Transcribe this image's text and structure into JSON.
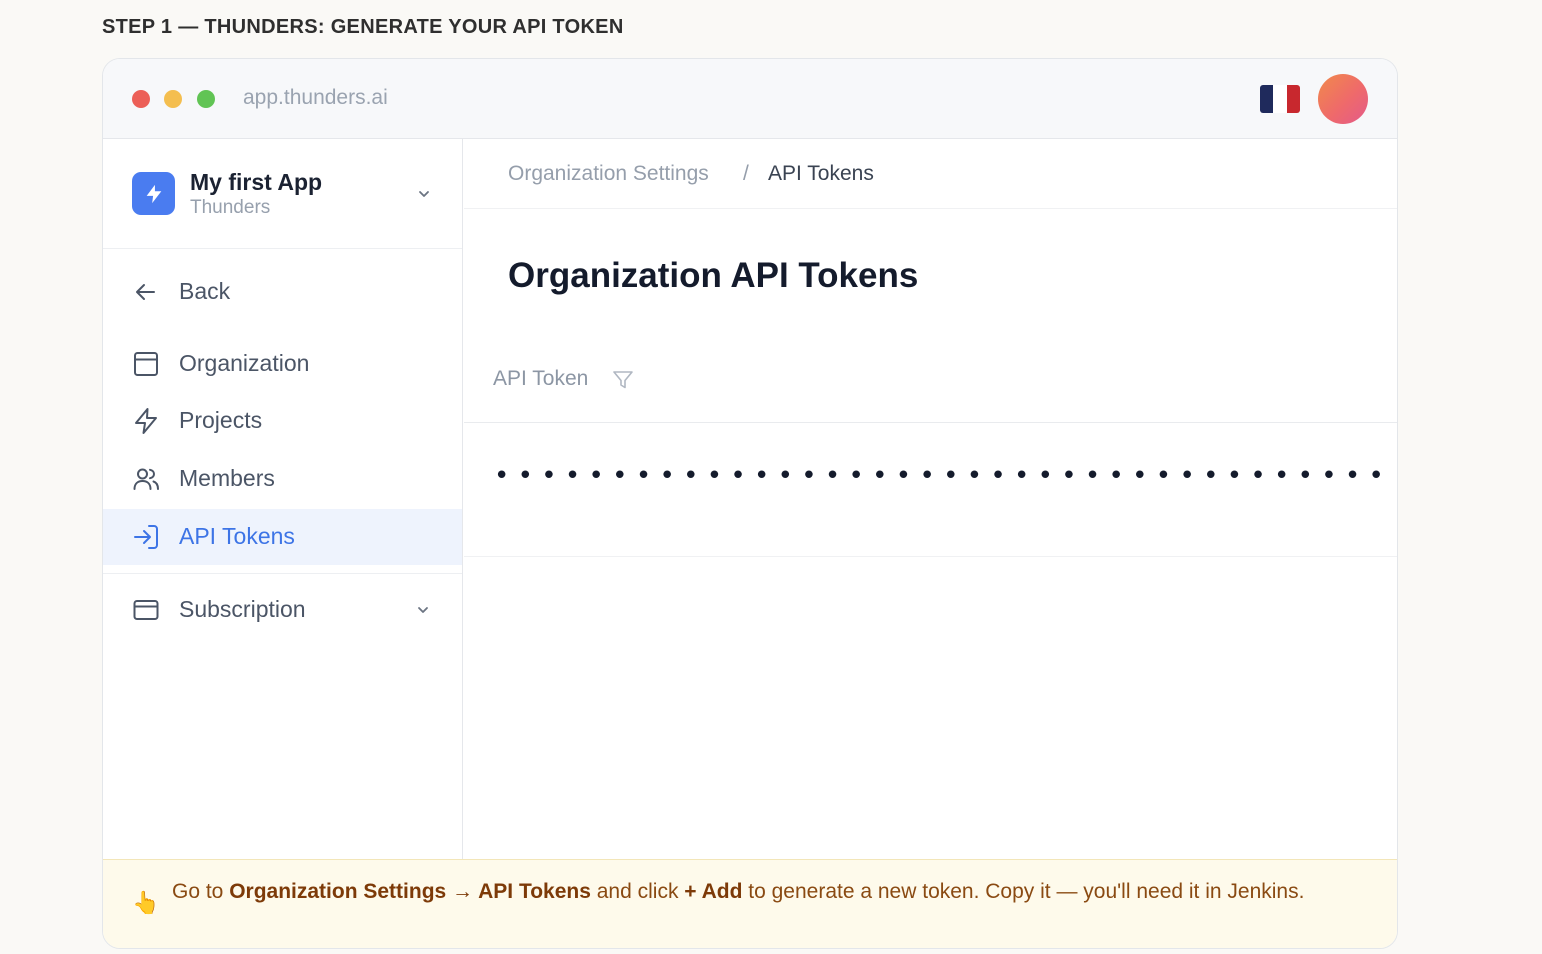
{
  "step": {
    "title": "STEP 1 — THUNDERS: GENERATE YOUR API TOKEN"
  },
  "browser": {
    "url": "app.thunders.ai",
    "flag": {
      "name": "france-flag",
      "colors": [
        "#1f2a5c",
        "#ffffff",
        "#c8282e"
      ]
    },
    "avatar": {
      "name": "user-avatar"
    }
  },
  "sidebar": {
    "app": {
      "name": "My first App",
      "org": "Thunders",
      "icon": "lightning-icon"
    },
    "back": {
      "label": "Back",
      "icon": "arrow-left-icon"
    },
    "items": [
      {
        "label": "Organization",
        "icon": "window-icon",
        "active": false
      },
      {
        "label": "Projects",
        "icon": "lightning-outline-icon",
        "active": false
      },
      {
        "label": "Members",
        "icon": "users-icon",
        "active": false
      },
      {
        "label": "API Tokens",
        "icon": "sign-in-icon",
        "active": true
      }
    ],
    "subscription": {
      "label": "Subscription",
      "icon": "card-icon"
    }
  },
  "main": {
    "breadcrumb": {
      "parent": "Organization Settings",
      "separator": "/",
      "current": "API Tokens"
    },
    "title": "Organization API Tokens",
    "table": {
      "column": "API Token",
      "rows": [
        {
          "token": "••••••••••••••••••••••••••••••••••••••••••••••"
        }
      ]
    }
  },
  "tip": {
    "emoji": "👆",
    "prefix": "Go to ",
    "path": "Organization Settings → API Tokens",
    "mid": " and click ",
    "action": "+ Add",
    "suffix": " to generate a new token. Copy it — you'll need it in Jenkins."
  },
  "colors": {
    "accent": "#3d74e6",
    "tip_bg": "#fefaeb",
    "tip_text": "#8a4a12"
  }
}
